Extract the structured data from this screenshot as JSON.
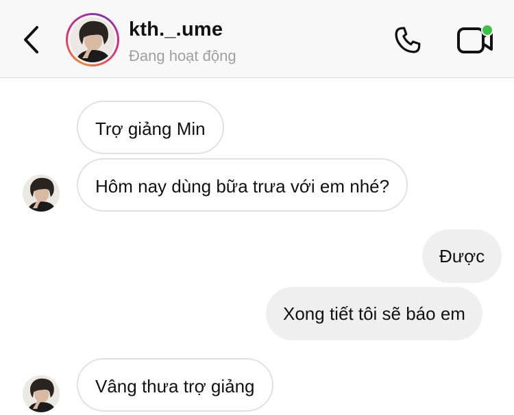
{
  "header": {
    "username": "kth._.ume",
    "status": "Đang hoạt động",
    "back_icon": "chevron-left-icon",
    "call_icon": "phone-icon",
    "video_icon": "video-camera-icon",
    "online_color": "#3cc046"
  },
  "messages": [
    {
      "direction": "incoming",
      "text": "Trợ giảng Min"
    },
    {
      "direction": "incoming",
      "text": "Hôm nay dùng bữa trưa với em nhé?"
    },
    {
      "direction": "outgoing",
      "text": "Được"
    },
    {
      "direction": "outgoing",
      "text": "Xong tiết tôi sẽ báo em"
    },
    {
      "direction": "incoming",
      "text": "Vâng thưa trợ giảng"
    }
  ],
  "colors": {
    "header_bg": "#f8f8f8",
    "incoming_border": "#e1e1e1",
    "outgoing_bg": "#efefef",
    "status_text": "#a0a0a0"
  }
}
